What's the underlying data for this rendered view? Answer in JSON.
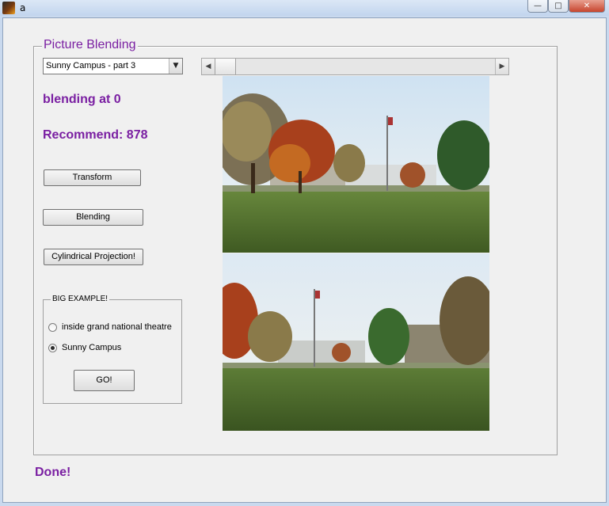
{
  "window": {
    "title": "a",
    "minimize_glyph": "—",
    "maximize_glyph": "□",
    "close_glyph": "✕"
  },
  "panel": {
    "title": "Picture Blending",
    "dataset_select": {
      "value": "Sunny Campus - part 3"
    },
    "slider": {
      "value": 0
    },
    "blending_label": "blending at 0",
    "recommend_label": "Recommend: 878",
    "buttons": {
      "transform": "Transform",
      "blending": "Blending",
      "cylindrical": "Cylindrical Projection!"
    },
    "example_group": {
      "title": "BIG EXAMPLE!",
      "options": [
        {
          "label": "inside grand national theatre",
          "selected": false
        },
        {
          "label": "Sunny Campus",
          "selected": true
        }
      ],
      "go_label": "GO!"
    }
  },
  "status": "Done!",
  "colors": {
    "accent": "#7a1fa2",
    "panel_bg": "#f0f0f0"
  }
}
